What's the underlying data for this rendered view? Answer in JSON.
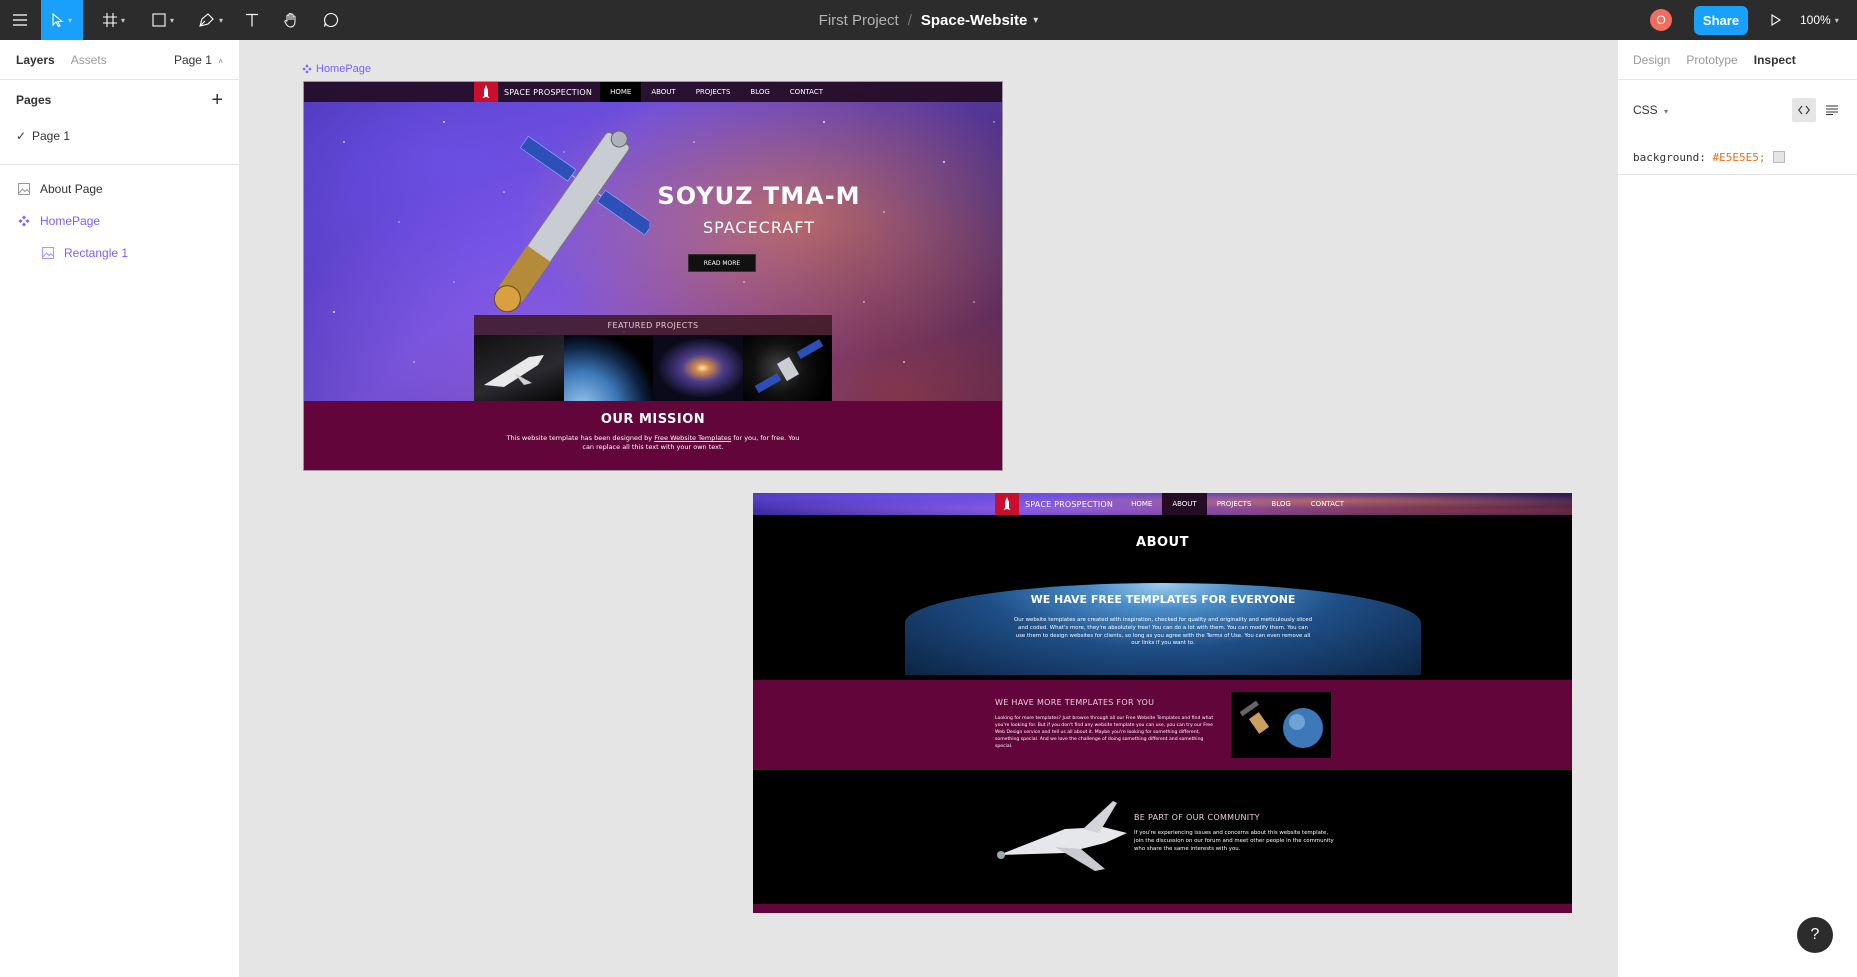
{
  "toolbar": {
    "project_name": "First Project",
    "separator": "/",
    "file_name": "Space-Website",
    "avatar_initial": "O",
    "share_label": "Share",
    "zoom": "100%"
  },
  "left_panel": {
    "tabs": [
      "Layers",
      "Assets"
    ],
    "current_page": "Page 1",
    "pages_heading": "Pages",
    "pages": [
      "Page 1"
    ],
    "layers": [
      {
        "label": "About Page",
        "icon": "image-frame-icon"
      },
      {
        "label": "HomePage",
        "icon": "component-icon"
      },
      {
        "label": "Rectangle 1",
        "icon": "image-frame-icon"
      }
    ]
  },
  "right_panel": {
    "tabs": [
      "Design",
      "Prototype",
      "Inspect"
    ],
    "code_language": "CSS",
    "css_property": "background:",
    "css_value": "#E5E5E5;",
    "help": "?"
  },
  "canvas": {
    "frame_label": "HomePage",
    "home": {
      "site_name": "SPACE PROSPECTION",
      "nav": [
        "HOME",
        "ABOUT",
        "PROJECTS",
        "BLOG",
        "CONTACT"
      ],
      "active_nav": "HOME",
      "hero_title": "SOYUZ TMA-M",
      "hero_subtitle": "SPACECRAFT",
      "read_more": "READ MORE",
      "featured": "FEATURED PROJECTS",
      "mission_title": "OUR MISSION",
      "mission_text_before": "This website template has been designed by ",
      "mission_link": "Free Website Templates",
      "mission_text_after": " for you, for free. You can replace all this text with your own text."
    },
    "about": {
      "site_name": "SPACE PROSPECTION",
      "nav": [
        "HOME",
        "ABOUT",
        "PROJECTS",
        "BLOG",
        "CONTACT"
      ],
      "active_nav": "ABOUT",
      "title": "ABOUT",
      "earth_heading": "WE HAVE FREE TEMPLATES FOR EVERYONE",
      "earth_text": "Our website templates are created with inspiration, checked for quality and originality and meticulously sliced and coded. What's more, they're absolutely free! You can do a lot with them. You can modify them. You can use them to design websites for clients, so long as you agree with the Terms of Use. You can even remove all our links if you want to.",
      "more_heading": "WE HAVE MORE TEMPLATES FOR YOU",
      "more_text": "Looking for more templates? Just browse through all our Free Website Templates and find what you're looking for. But if you don't find any website template you can use, you can try our Free Web Design service and tell us all about it. Maybe you're looking for something different, something special. And we love the challenge of doing something different and something special.",
      "community_heading": "BE PART OF OUR COMMUNITY",
      "community_text": "If you're experiencing issues and concerns about this website template, join the discussion on our forum and meet other people in the community who share the same interests with you."
    }
  }
}
